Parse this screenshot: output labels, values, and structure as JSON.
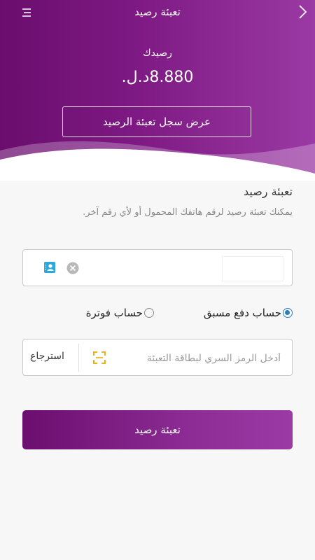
{
  "header": {
    "title": "تعبئة رصيد",
    "balance_label": "رصيدك",
    "balance_value": "8.880د.ل.",
    "history_button": "عرض سجل تعبئة الرصيد"
  },
  "topup": {
    "section_title": "تعبئة رصيد",
    "section_subtitle": "يمكنك تعبئة رصيد لرقم هاتفك المحمول أو لأي رقم آخر.",
    "phone_value": "",
    "account_types": [
      {
        "label": "حساب دفع مسبق",
        "selected": true
      },
      {
        "label": "حساب فوترة",
        "selected": false
      }
    ],
    "card_placeholder": "أدخل الرمز السري لبطاقة التعبئة",
    "redeem_label": "استرجاع",
    "submit_label": "تعبئة رصيد"
  },
  "colors": {
    "brand_purple": "#7a1880",
    "radio_blue": "#2b7fb8",
    "scan_orange": "#f0a500",
    "contact_teal": "#2ea8d8"
  },
  "icons": [
    "menu-icon",
    "chevron-right-icon",
    "contact-book-icon",
    "clear-icon",
    "scan-icon"
  ]
}
